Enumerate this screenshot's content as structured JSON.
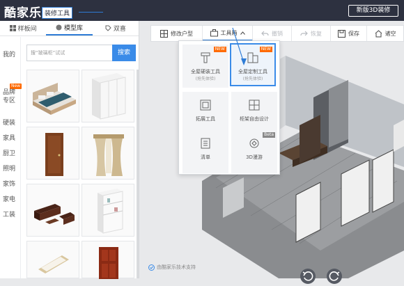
{
  "header": {
    "logo": "酷家乐",
    "tool_tag": "装修工具",
    "btn_3d": "新版3D装修"
  },
  "left_panel": {
    "tabs": [
      {
        "label": "样板间",
        "icon": "grid-icon"
      },
      {
        "label": "模型库",
        "icon": "circle-icon"
      },
      {
        "label": "双喜",
        "icon": "tag-icon"
      }
    ],
    "categories": [
      "我的",
      "品牌专区",
      "硬装",
      "家具",
      "厨卫",
      "照明",
      "家饰",
      "家电",
      "工装"
    ],
    "category_new": "New",
    "search_placeholder": "搜“玻璃柜”试试",
    "search_btn": "搜索"
  },
  "toolbar": {
    "items": [
      {
        "label": "修改户型",
        "icon": "floorplan-icon"
      },
      {
        "label": "工具箱",
        "icon": "toolbox-icon"
      },
      {
        "label": "撤销",
        "icon": "undo-icon"
      },
      {
        "label": "恢复",
        "icon": "redo-icon"
      },
      {
        "label": "保存",
        "icon": "save-icon"
      },
      {
        "label": "诸空",
        "icon": "clear-icon"
      }
    ]
  },
  "dropdown": {
    "items": [
      {
        "label": "全屋硬装工具",
        "sub": "(抢先体验)",
        "badge": "NEW"
      },
      {
        "label": "全屋定制工具",
        "sub": "(抢先体验)",
        "badge": "NEW"
      },
      {
        "label": "拓展工具",
        "sub": "",
        "badge": ""
      },
      {
        "label": "柜架自由设计",
        "sub": "",
        "badge": ""
      },
      {
        "label": "清单",
        "sub": "",
        "badge": ""
      },
      {
        "label": "3D漫游",
        "sub": "",
        "badge": "Beta"
      }
    ]
  },
  "footer_note": "由酷家乐技术支持",
  "colors": {
    "accent": "#3a8be8",
    "topbar": "#2d3140",
    "badge": "#ff6a00"
  }
}
